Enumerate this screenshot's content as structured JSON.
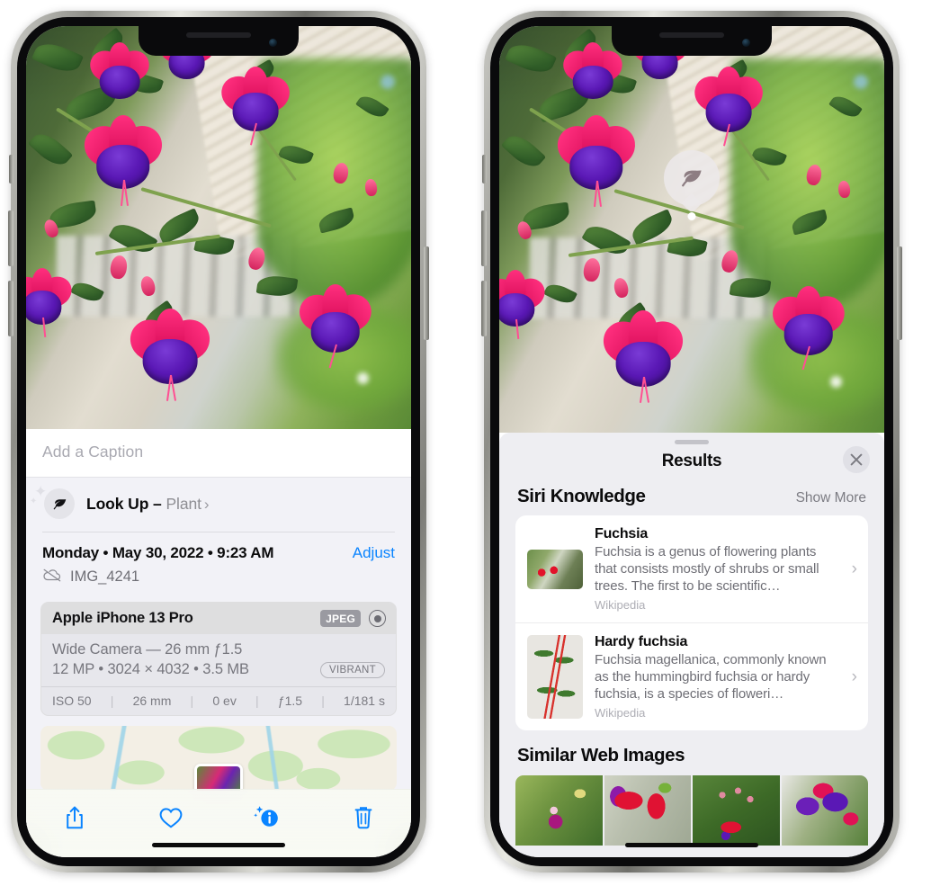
{
  "left_phone": {
    "name": "photos-detail-phone",
    "caption": {
      "placeholder": "Add a Caption",
      "value": ""
    },
    "lookup": {
      "icon": "leaf-icon",
      "label": "Look Up",
      "dash": " – ",
      "subject": "Plant",
      "chevron": "›"
    },
    "meta": {
      "date": "Monday • May 30, 2022 • 9:23 AM",
      "adjust_label": "Adjust",
      "filename": "IMG_4241",
      "cloud_icon": "icloud-slash-icon"
    },
    "camera_card": {
      "device": "Apple iPhone 13 Pro",
      "format_badge": "JPEG",
      "lens_icon": "lens-icon",
      "lens_line": "Wide Camera — 26 mm ƒ1.5",
      "size_line": "12 MP • 3024 × 4032 • 3.5 MB",
      "style_badge": "VIBRANT",
      "exif": [
        "ISO 50",
        "26 mm",
        "0 ev",
        "ƒ1.5",
        "1/181 s"
      ]
    },
    "map": {
      "name": "photo-location-map",
      "pin_label": ""
    },
    "toolbar": [
      {
        "name": "share-button",
        "icon": "share-icon"
      },
      {
        "name": "favorite-button",
        "icon": "heart-icon"
      },
      {
        "name": "info-button",
        "icon": "info-sparkle-icon"
      },
      {
        "name": "delete-button",
        "icon": "trash-icon"
      }
    ]
  },
  "right_phone": {
    "name": "visual-lookup-results-phone",
    "badge": {
      "icon": "leaf-icon"
    },
    "sheet": {
      "title": "Results",
      "close_icon": "close-icon",
      "sections": [
        {
          "title": "Siri Knowledge",
          "action": "Show More",
          "items": [
            {
              "title": "Fuchsia",
              "description": "Fuchsia is a genus of flowering plants that consists mostly of shrubs or small trees. The first to be scientific…",
              "source": "Wikipedia",
              "chevron": "›"
            },
            {
              "title": "Hardy fuchsia",
              "description": "Fuchsia magellanica, commonly known as the hummingbird fuchsia or hardy fuchsia, is a species of floweri…",
              "source": "Wikipedia",
              "chevron": "›"
            }
          ]
        },
        {
          "title": "Similar Web Images",
          "action": "",
          "thumbnails": [
            "web-image-1",
            "web-image-2",
            "web-image-3",
            "web-image-4"
          ]
        }
      ]
    }
  },
  "colors": {
    "accent_blue": "#0a84ff",
    "sheet_gray": "#f2f2f7",
    "results_gray": "#eeeef2",
    "secondary_text": "#8e8e93"
  }
}
